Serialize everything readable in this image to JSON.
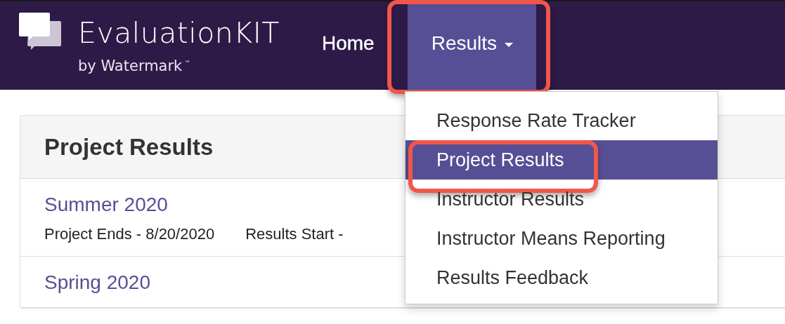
{
  "brand": {
    "name": "EvaluationKIT",
    "tagline": "by Watermark",
    "trademark": "™"
  },
  "nav": [
    {
      "label": "Home",
      "selected": false,
      "highlighted": false,
      "dropdown": false
    },
    {
      "label": "Results",
      "selected": true,
      "highlighted": true,
      "dropdown": true
    }
  ],
  "dropdown_menu": [
    {
      "label": "Response Rate Tracker",
      "selected": false,
      "highlighted": false
    },
    {
      "label": "Project Results",
      "selected": true,
      "highlighted": true
    },
    {
      "label": "Instructor Results",
      "selected": false,
      "highlighted": false
    },
    {
      "label": "Instructor Means Reporting",
      "selected": false,
      "highlighted": false
    },
    {
      "label": "Results Feedback",
      "selected": false,
      "highlighted": false
    }
  ],
  "panel": {
    "title": "Project Results",
    "projects": [
      {
        "name": "Summer 2020",
        "details": [
          "Project Ends - 8/20/2020",
          "Results Start -"
        ]
      },
      {
        "name": "Spring 2020"
      }
    ]
  }
}
